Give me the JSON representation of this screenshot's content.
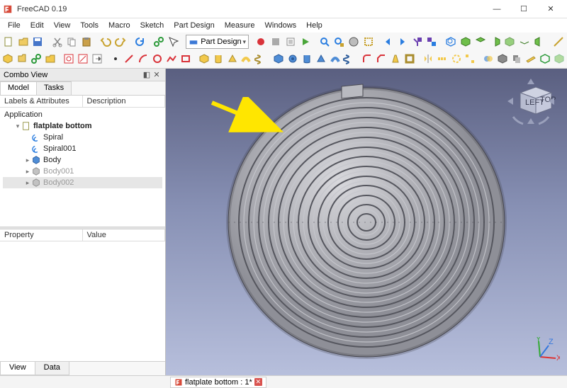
{
  "app": {
    "title": "FreeCAD 0.19"
  },
  "menu": [
    "File",
    "Edit",
    "View",
    "Tools",
    "Macro",
    "Sketch",
    "Part Design",
    "Measure",
    "Windows",
    "Help"
  ],
  "workbench_selector": "Part Design",
  "combo_view": {
    "title": "Combo View",
    "tabs": [
      "Model",
      "Tasks"
    ],
    "active_tab": 0,
    "tree_headers": [
      "Labels & Attributes",
      "Description"
    ],
    "app_label": "Application",
    "doc": {
      "label": "flatplate bottom",
      "items": [
        {
          "label": "Spiral",
          "icon": "spiral",
          "muted": false
        },
        {
          "label": "Spiral001",
          "icon": "spiral",
          "muted": false
        },
        {
          "label": "Body",
          "icon": "body",
          "muted": false,
          "expandable": true
        },
        {
          "label": "Body001",
          "icon": "body",
          "muted": true,
          "expandable": true
        },
        {
          "label": "Body002",
          "icon": "body",
          "muted": true,
          "expandable": true,
          "selected": true
        }
      ]
    },
    "prop_headers": [
      "Property",
      "Value"
    ],
    "bottom_tabs": [
      "View",
      "Data"
    ],
    "active_bottom_tab": 0
  },
  "navcube": {
    "faces": [
      "LEFT",
      "TOP"
    ]
  },
  "axes": [
    "X",
    "Y",
    "Z"
  ],
  "status": {
    "doc_label": "flatplate bottom : 1*"
  }
}
